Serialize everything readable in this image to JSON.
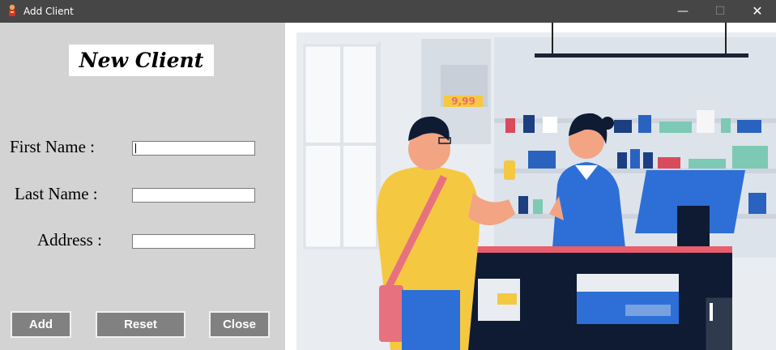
{
  "window": {
    "title": "Add Client",
    "minimize_glyph": "—",
    "maximize_glyph": "☐",
    "close_glyph": "✕"
  },
  "form": {
    "heading": "New Client",
    "fields": [
      {
        "label": "First Name :",
        "value": ""
      },
      {
        "label": "Last Name :",
        "value": ""
      },
      {
        "label": "Address :",
        "value": ""
      }
    ]
  },
  "buttons": {
    "add": "Add",
    "reset": "Reset",
    "close": "Close"
  },
  "illustration": {
    "price_tag": "9,99"
  },
  "colors": {
    "titlebar": "#464646",
    "panel": "#d3d3d3",
    "button": "#818181",
    "counter_blue": "#2d6fd6",
    "shirt_yellow": "#f5c842"
  },
  "icons": [
    "app-icon",
    "minimize-icon",
    "maximize-icon",
    "close-icon"
  ]
}
